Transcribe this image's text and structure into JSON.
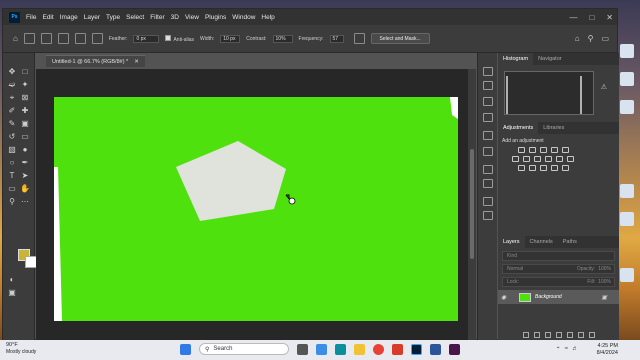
{
  "app": {
    "menu": [
      "File",
      "Edit",
      "Image",
      "Layer",
      "Type",
      "Select",
      "Filter",
      "3D",
      "View",
      "Plugins",
      "Window",
      "Help"
    ],
    "logo": "Ps"
  },
  "options": {
    "feather_label": "Feather:",
    "feather_value": "0 px",
    "antialias_label": "Anti-alias",
    "width_label": "Width:",
    "width_value": "10 px",
    "contrast_label": "Contrast:",
    "contrast_value": "10%",
    "frequency_label": "Frequency:",
    "frequency_value": "57",
    "select_mask_label": "Select and Mask..."
  },
  "document": {
    "tab_title": "Untitled-1 @ 66.7% (RGB/8#) *",
    "canvas_color": "#4fe10e",
    "shape_color": "#dfe3dc"
  },
  "panels": {
    "histogram_tabs": [
      "Histogram",
      "Navigator"
    ],
    "adjust_tabs": [
      "Adjustments",
      "Libraries"
    ],
    "adjust_title": "Add an adjustment",
    "layer_tabs": [
      "Layers",
      "Channels",
      "Paths"
    ],
    "kind_label": "Kind",
    "blend_mode": "Normal",
    "opacity_label": "Opacity:",
    "opacity_value": "100%",
    "lock_label": "Lock:",
    "fill_label": "Fill:",
    "fill_value": "100%",
    "layer_name": "Background"
  },
  "taskbar": {
    "temperature": "90°F",
    "weather": "Mostly cloudy",
    "search_placeholder": "Search",
    "time": "4:25 PM",
    "date": "8/4/2024"
  },
  "colors": {
    "foreground": "#c9b43a",
    "background": "#ffffff"
  }
}
